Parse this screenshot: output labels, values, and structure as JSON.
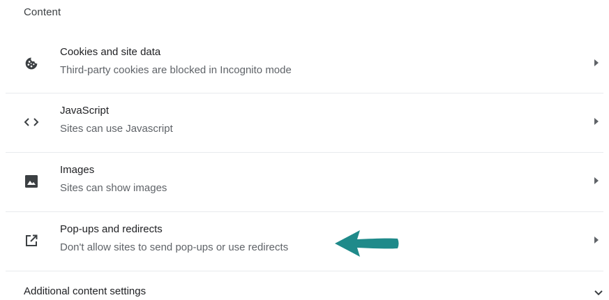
{
  "section": {
    "title": "Content"
  },
  "items": [
    {
      "title": "Cookies and site data",
      "subtitle": "Third-party cookies are blocked in Incognito mode",
      "icon": "cookie-icon"
    },
    {
      "title": "JavaScript",
      "subtitle": "Sites can use Javascript",
      "icon": "code-icon"
    },
    {
      "title": "Images",
      "subtitle": "Sites can show images",
      "icon": "image-icon"
    },
    {
      "title": "Pop-ups and redirects",
      "subtitle": "Don't allow sites to send pop-ups or use redirects",
      "icon": "open-in-new-icon"
    }
  ],
  "additional": {
    "label": "Additional content settings",
    "icon": "chevron-down-icon"
  },
  "colors": {
    "icon": "#3c4043",
    "callout_arrow": "#1f8a8a",
    "divider": "#e8eaed"
  }
}
